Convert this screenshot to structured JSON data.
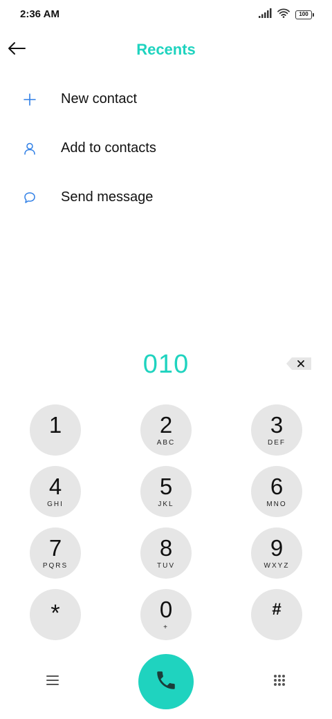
{
  "status_bar": {
    "time": "2:36 AM",
    "battery": "100",
    "icons": [
      "signal-icon",
      "wifi-icon",
      "battery-icon"
    ]
  },
  "header": {
    "title": "Recents",
    "back_icon": "arrow-left-icon"
  },
  "actions": [
    {
      "label": "New contact",
      "icon": "plus-icon"
    },
    {
      "label": "Add to contacts",
      "icon": "person-icon"
    },
    {
      "label": "Send message",
      "icon": "chat-bubble-icon"
    }
  ],
  "dialer": {
    "number": "010",
    "backspace_icon": "backspace-icon"
  },
  "keypad": [
    {
      "digit": "1",
      "letters": ""
    },
    {
      "digit": "2",
      "letters": "ABC"
    },
    {
      "digit": "3",
      "letters": "DEF"
    },
    {
      "digit": "4",
      "letters": "GHI"
    },
    {
      "digit": "5",
      "letters": "JKL"
    },
    {
      "digit": "6",
      "letters": "MNO"
    },
    {
      "digit": "7",
      "letters": "PQRS"
    },
    {
      "digit": "8",
      "letters": "TUV"
    },
    {
      "digit": "9",
      "letters": "WXYZ"
    },
    {
      "digit": "*",
      "letters": ""
    },
    {
      "digit": "0",
      "letters": "+"
    },
    {
      "digit": "#",
      "letters": ""
    }
  ],
  "bottom_bar": {
    "menu_icon": "menu-icon",
    "call_icon": "phone-icon",
    "keypad_icon": "dialpad-icon"
  },
  "colors": {
    "accent": "#1fd3bf",
    "icon_blue": "#2f7fe6",
    "key_background": "#e6e6e6"
  }
}
